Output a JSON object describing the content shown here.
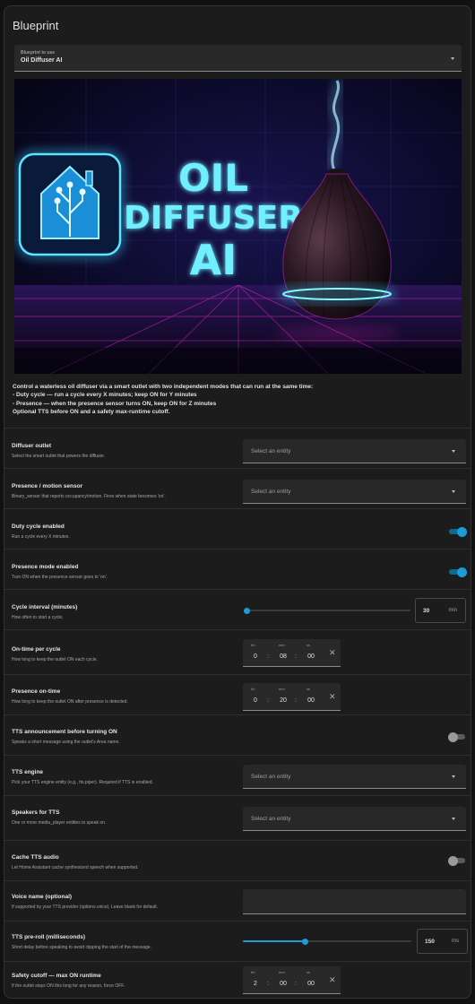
{
  "card": {
    "title": "Blueprint"
  },
  "blueprint_select": {
    "label": "Blueprint to use",
    "value": "Oil Diffuser AI"
  },
  "hero": {
    "line1": "OIL",
    "line2": "DIFFUSER",
    "line3": "AI"
  },
  "description": {
    "intro": "Control a waterless oil diffuser via a smart outlet with two independent modes that can run at the same time:",
    "bullet1": "- Duty cycle — run a cycle every X minutes; keep ON for Y minutes",
    "bullet2": "- Presence — when the presence sensor turns ON, keep ON for Z minutes",
    "outro": "Optional TTS before ON and a safety max-runtime cutoff."
  },
  "fields": {
    "diffuser_outlet": {
      "title": "Diffuser outlet",
      "subtitle": "Select the smart outlet that powers the diffuser.",
      "placeholder": "Select an entity"
    },
    "presence_sensor": {
      "title": "Presence / motion sensor",
      "subtitle": "Binary_sensor that reports occupancy/motion. Fires when state becomes 'on'.",
      "placeholder": "Select an entity"
    },
    "duty_cycle_enabled": {
      "title": "Duty cycle enabled",
      "subtitle": "Run a cycle every X minutes.",
      "state": "on"
    },
    "presence_mode_enabled": {
      "title": "Presence mode enabled",
      "subtitle": "Turn ON when the presence sensor goes to 'on'.",
      "state": "on"
    },
    "cycle_interval": {
      "title": "Cycle interval (minutes)",
      "subtitle": "How often to start a cycle.",
      "value": "30",
      "unit": "min",
      "fraction": 0.0
    },
    "on_time_per_cycle": {
      "title": "On-time per cycle",
      "subtitle": "How long to keep the outlet ON each cycle.",
      "hh_label": "hh",
      "mm_label": "mm",
      "ss_label": "ss",
      "hh": "0",
      "mm": "08",
      "ss": "00"
    },
    "presence_on_time": {
      "title": "Presence on-time",
      "subtitle": "How long to keep the outlet ON after presence is detected.",
      "hh_label": "hh",
      "mm_label": "mm",
      "ss_label": "ss",
      "hh": "0",
      "mm": "20",
      "ss": "00"
    },
    "tts_announcement": {
      "title": "TTS announcement before turning ON",
      "subtitle": "Speaks a short message using the outlet's Area name.",
      "state": "off"
    },
    "tts_engine": {
      "title": "TTS engine",
      "subtitle": "Pick your TTS engine entity (e.g., tts.piper). Required if TTS is enabled.",
      "placeholder": "Select an entity"
    },
    "speakers": {
      "title": "Speakers for TTS",
      "subtitle": "One or more media_player entities to speak on.",
      "placeholder": "Select an entity"
    },
    "cache_tts": {
      "title": "Cache TTS audio",
      "subtitle": "Let Home Assistant cache synthesized speech when supported.",
      "state": "off"
    },
    "voice_name": {
      "title": "Voice name (optional)",
      "subtitle": "If supported by your TTS provider (options.voice). Leave blank for default.",
      "value": ""
    },
    "tts_preroll": {
      "title": "TTS pre-roll (milliseconds)",
      "subtitle": "Short delay before speaking to avoid clipping the start of the message.",
      "value": "150",
      "unit": "ms",
      "fraction": 0.37
    },
    "safety_cutoff": {
      "title": "Safety cutoff — max ON runtime",
      "subtitle": "If the outlet stays ON this long for any reason, force OFF.",
      "hh_label": "hh",
      "mm_label": "mm",
      "ss_label": "ss",
      "hh": "2",
      "mm": "00",
      "ss": "00"
    }
  },
  "colors": {
    "accent": "#1e9ad6",
    "neon_cyan": "#38d8ff",
    "neon_magenta": "#ff2bd6",
    "background": "#1c1c1c"
  },
  "icons": {
    "dropdown": "chevron-down-icon",
    "clear": "close-icon",
    "logo": "home-assistant-logo"
  }
}
